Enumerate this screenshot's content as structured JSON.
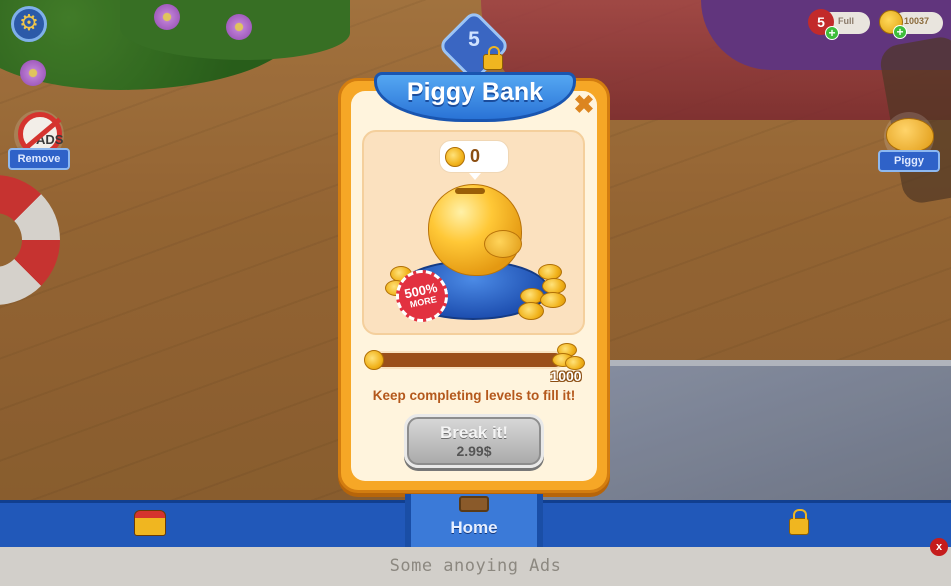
{
  "hud": {
    "level": "5",
    "lives_count": "5",
    "lives_status": "Full",
    "coins": "10037",
    "plus": "+"
  },
  "side_buttons": {
    "remove_ads": {
      "icon_text": "ADS",
      "label": "Remove"
    },
    "piggy": {
      "label": "Piggy"
    }
  },
  "modal": {
    "title": "Piggy Bank",
    "close_glyph": "✖",
    "coin_count": "0",
    "badge_percent": "500%",
    "badge_more": "MORE",
    "progress": {
      "current": 0,
      "max": 1000,
      "max_label": "1000"
    },
    "hint": "Keep completing levels to fill it!",
    "break_button": {
      "label": "Break it!",
      "price": "2.99$"
    }
  },
  "nav": {
    "home_label": "Home"
  },
  "ad": {
    "text": "Some anoying Ads",
    "close_glyph": "x"
  },
  "colors": {
    "modal_orange": "#f6a726",
    "title_blue": "#2a73d6",
    "nav_blue": "#2158b9",
    "coin_gold": "#f1b31c"
  }
}
